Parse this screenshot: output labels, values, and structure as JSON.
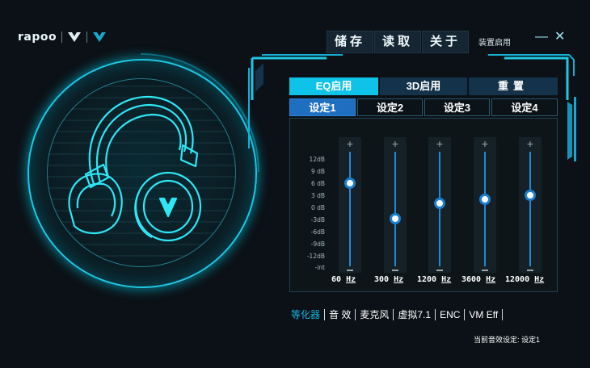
{
  "brand": {
    "name": "rapoo"
  },
  "toolbar": {
    "save_label": "储存",
    "read_label": "读取",
    "about_label": "关于",
    "device_enable": "装置启用"
  },
  "window": {
    "minimize": "—",
    "close": "✕"
  },
  "tabs": [
    {
      "label": "EQ启用",
      "active": true
    },
    {
      "label": "3D启用",
      "active": false
    },
    {
      "label": "重置",
      "active": false
    }
  ],
  "presets": [
    {
      "label": "设定1",
      "active": true
    },
    {
      "label": "设定2",
      "active": false
    },
    {
      "label": "设定3",
      "active": false
    },
    {
      "label": "设定4",
      "active": false
    }
  ],
  "eq": {
    "scale": [
      "12dB",
      "9 dB",
      "6 dB",
      "3 dB",
      "0 dB",
      "-3dB",
      "-6dB",
      "-9dB",
      "-12dB",
      "-int"
    ],
    "bands": [
      {
        "freq": "60",
        "unit": "Hz",
        "gain_db": 6
      },
      {
        "freq": "300",
        "unit": "Hz",
        "gain_db": -3
      },
      {
        "freq": "1200",
        "unit": "Hz",
        "gain_db": 1
      },
      {
        "freq": "3600",
        "unit": "Hz",
        "gain_db": 2
      },
      {
        "freq": "12000",
        "unit": "Hz",
        "gain_db": 3
      }
    ],
    "plus": "+",
    "accent": "#1a7fd0"
  },
  "bottom_nav": [
    {
      "label": "等化器",
      "active": true
    },
    {
      "label": "音 效",
      "active": false
    },
    {
      "label": "麦克风",
      "active": false
    },
    {
      "label": "虚拟7.1",
      "active": false
    },
    {
      "label": "ENC",
      "active": false
    },
    {
      "label": "VM Eff",
      "active": false
    }
  ],
  "status": {
    "text": "当前音效设定: 设定1"
  },
  "colors": {
    "accent": "#0fc2e8",
    "background": "#0b1116",
    "glow": "#1fc7e3"
  }
}
